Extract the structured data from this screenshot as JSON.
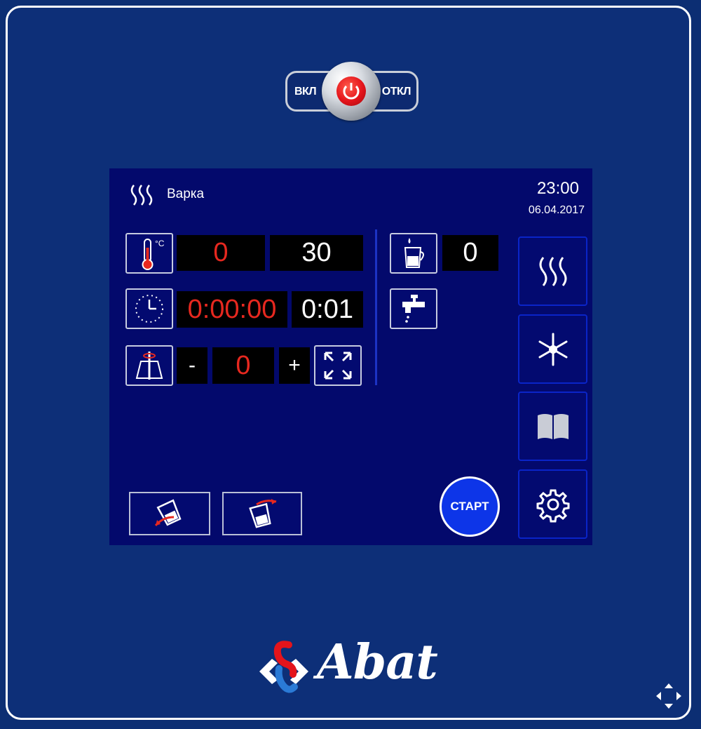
{
  "power": {
    "on_label": "ВКЛ",
    "off_label": "ОТКЛ"
  },
  "header": {
    "mode_title": "Варка",
    "time": "23:00",
    "date": "06.04.2017"
  },
  "temperature": {
    "current": "0",
    "target": "30",
    "unit_icon": "thermometer-celsius-icon"
  },
  "timer": {
    "current": "0:00:00",
    "target": "0:01",
    "icon": "clock-icon"
  },
  "mixer": {
    "minus_label": "-",
    "value": "0",
    "plus_label": "+",
    "icon": "mixer-icon"
  },
  "water": {
    "volume": "0",
    "icons": [
      "water-jug-icon",
      "water-tap-icon"
    ]
  },
  "side_menu": {
    "items": [
      "steam-mode-icon",
      "cooling-mode-icon",
      "recipe-book-icon",
      "settings-gear-icon"
    ]
  },
  "controls": {
    "start_label": "СТАРТ"
  },
  "brand": {
    "name": "Abat"
  },
  "colors": {
    "panel": "#0d2f78",
    "screen": "#03096c",
    "active_value": "#e7281f",
    "start_button": "#0d35e8"
  }
}
